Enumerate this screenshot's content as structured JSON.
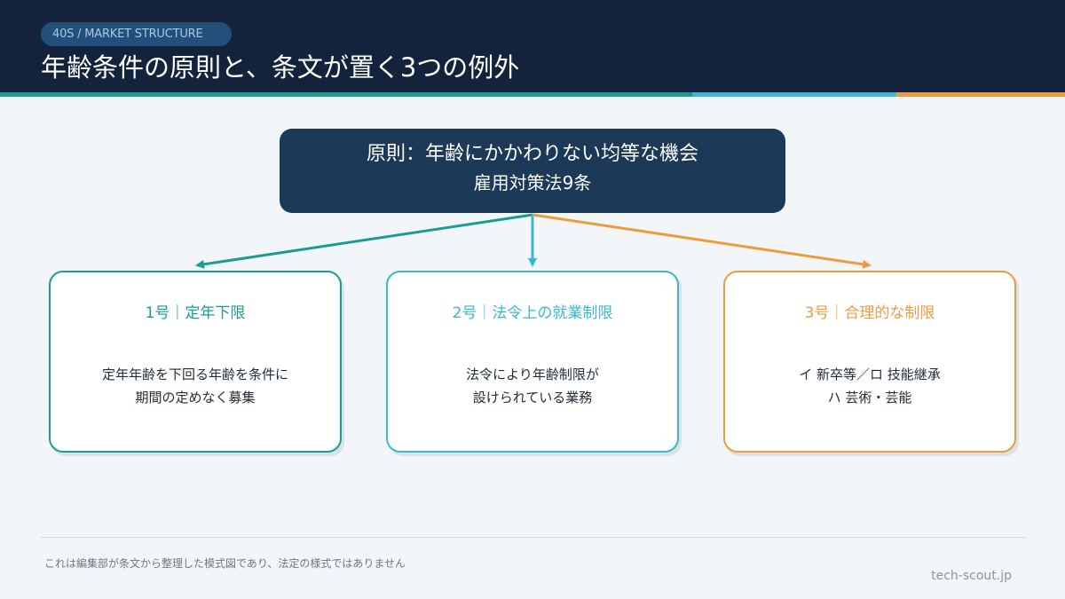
{
  "header": {
    "tag": "40S / MARKET STRUCTURE",
    "title": "年齢条件の原則と、条文が置く3つの例外"
  },
  "principle": {
    "line1": "原則：年齢にかかわりない均等な機会",
    "line2": "雇用対策法9条"
  },
  "exceptions": [
    {
      "heading": "1号｜定年下限",
      "body_line1": "定年年齢を下回る年齢を条件に",
      "body_line2": "期間の定めなく募集",
      "color": "#1a9c94"
    },
    {
      "heading": "2号｜法令上の就業制限",
      "body_line1": "法令により年齢制限が",
      "body_line2": "設けられている業務",
      "color": "#3cb6d2"
    },
    {
      "heading": "3号｜合理的な制限",
      "body_line1": "イ 新卒等／ロ 技能継承",
      "body_line2": "ハ 芸術・芸能",
      "color": "#ec9c40"
    }
  ],
  "footer": {
    "note": "これは編集部が条文から整理した模式図であり、法定の様式ではありません",
    "site": "tech-scout.jp"
  },
  "colors": {
    "navy": "#13233c",
    "teal": "#1a9c94",
    "cyan": "#3cb6d2",
    "orange": "#ec9c40"
  }
}
